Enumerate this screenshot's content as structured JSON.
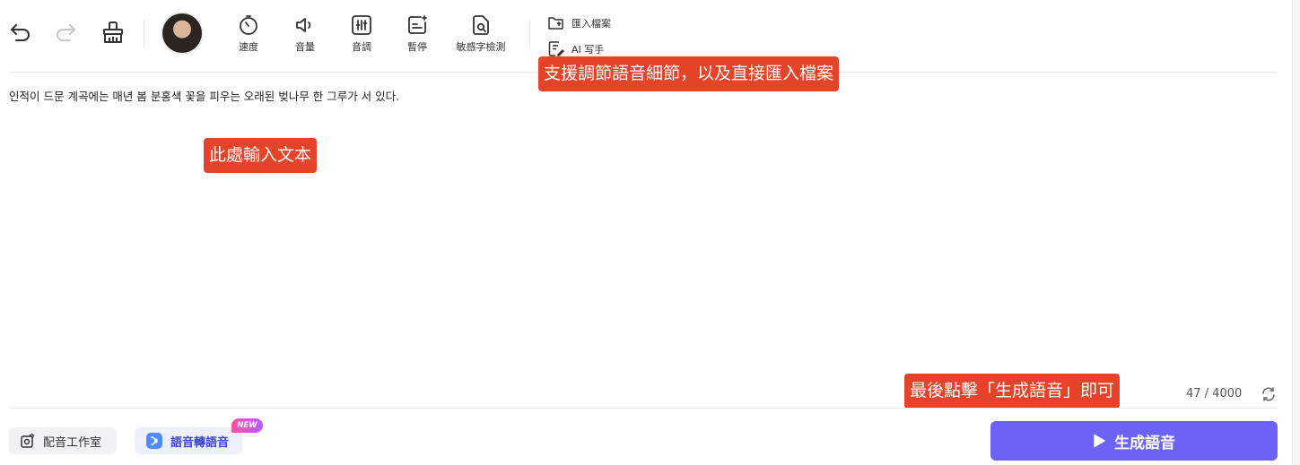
{
  "toolbar": {
    "tools": [
      {
        "label": "速度",
        "icon": "speed-icon"
      },
      {
        "label": "音量",
        "icon": "volume-icon"
      },
      {
        "label": "音調",
        "icon": "pitch-icon"
      },
      {
        "label": "暫停",
        "icon": "pause-insert-icon"
      },
      {
        "label": "敏感字檢測",
        "icon": "sensitive-word-check-icon"
      }
    ],
    "import_file_label": "匯入檔案",
    "ai_writer_label": "AI 写手"
  },
  "editor": {
    "text": "인적이 드문 계곡에는 매년 봄 분홍색 꽃을 피우는 오래된 벚나무 한 그루가 서 있다.",
    "char_count": "47 / 4000"
  },
  "callouts": {
    "toolbar_tip": "支援調節語音細節，以及直接匯入檔案",
    "input_tip": "此處輸入文本",
    "generate_tip": "最後點擊「生成語音」即可"
  },
  "footer": {
    "dubbing_studio_label": "配音工作室",
    "speech_to_speech_label": "語音轉語音",
    "new_badge": "NEW",
    "generate_label": "生成語音"
  },
  "colors": {
    "accent": "#6b63f6",
    "callout": "#e5432a",
    "badge_start": "#ff4fa6",
    "badge_end": "#b35cff"
  }
}
